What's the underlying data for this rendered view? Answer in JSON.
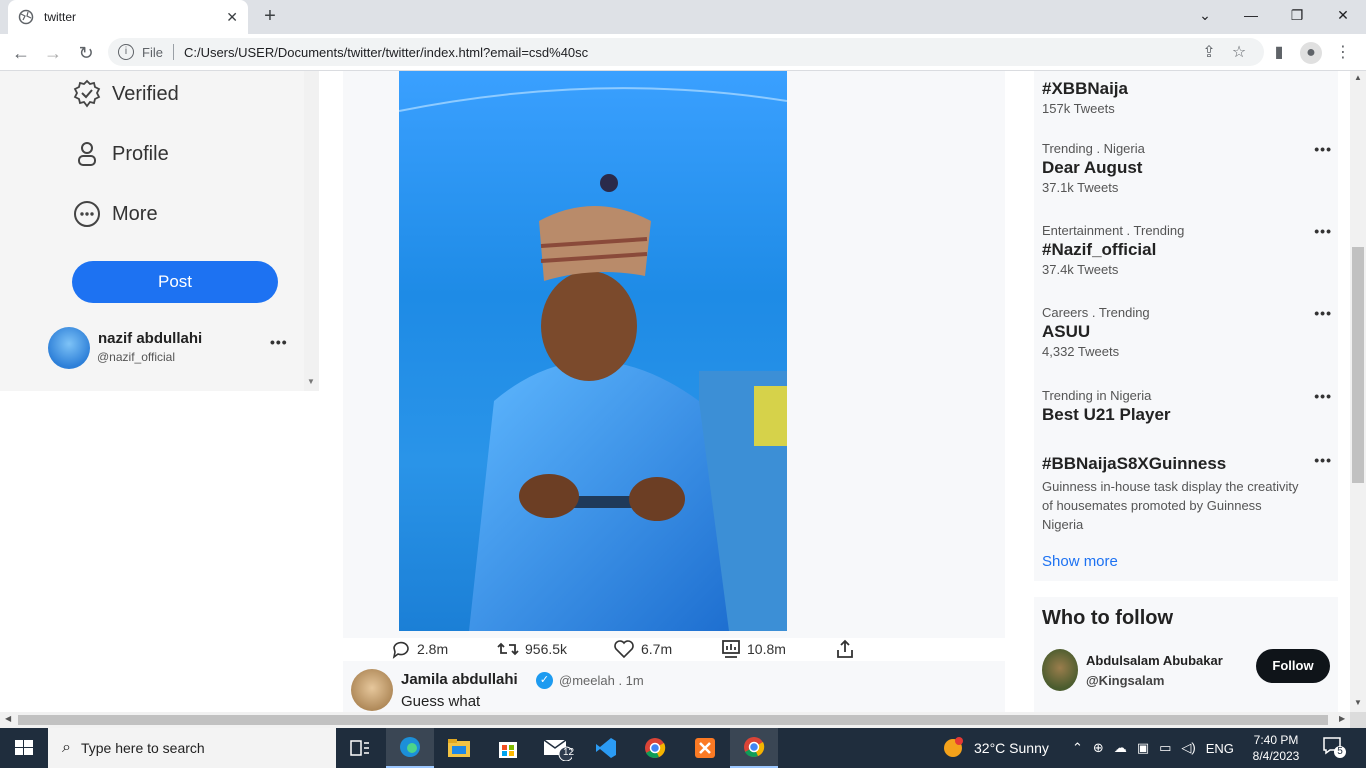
{
  "browser": {
    "tab_title": "twitter",
    "close_glyph": "✕",
    "newtab_glyph": "+",
    "file_label": "File",
    "url": "C:/Users/USER/Documents/twitter/twitter/index.html?email=csd%40sc"
  },
  "sidebar": {
    "items": [
      {
        "label": "Verified",
        "icon": "verified-badge-icon"
      },
      {
        "label": "Profile",
        "icon": "person-icon"
      },
      {
        "label": "More",
        "icon": "more-circle-icon"
      }
    ],
    "post_label": "Post",
    "user": {
      "name": "nazif abdullahi",
      "handle": "@nazif_official",
      "dots": "•••"
    }
  },
  "post": {
    "actions": [
      {
        "icon": "reply-icon",
        "count": "2.8m"
      },
      {
        "icon": "retweet-icon",
        "count": "956.5k"
      },
      {
        "icon": "like-icon",
        "count": "6.7m"
      },
      {
        "icon": "views-icon",
        "count": "10.8m"
      },
      {
        "icon": "share-icon",
        "count": ""
      }
    ]
  },
  "next_post": {
    "name": "Jamila abdullahi",
    "verified_glyph": "✓",
    "meta": "@meelah . 1m",
    "text": "Guess what"
  },
  "trends": {
    "items": [
      {
        "category": "",
        "tag": "#XBBNaija",
        "count": "157k Tweets"
      },
      {
        "category": "Trending . Nigeria",
        "tag": "Dear August",
        "count": "37.1k Tweets"
      },
      {
        "category": "Entertainment . Trending",
        "tag": "#Nazif_official",
        "count": "37.4k Tweets"
      },
      {
        "category": "Careers . Trending",
        "tag": "ASUU",
        "count": "4,332 Tweets"
      },
      {
        "category": "Trending in Nigeria",
        "tag": "Best U21 Player",
        "count": ""
      },
      {
        "category": "",
        "tag": "#BBNaijaS8XGuinness",
        "count": "",
        "desc": "Guinness in-house task display the creativity of housemates promoted by Guinness Nigeria"
      }
    ],
    "dots": "•••",
    "show_more": "Show more"
  },
  "who_to_follow": {
    "heading": "Who to follow",
    "name": "Abdulsalam Abubakar",
    "handle": "@Kingsalam",
    "follow_label": "Follow"
  },
  "taskbar": {
    "search_placeholder": "Type here to search",
    "weather": "32°C  Sunny",
    "language": "ENG",
    "time": "7:40 PM",
    "date": "8/4/2023",
    "notifications": "5",
    "mail_badge": "12"
  },
  "colors": {
    "accent": "#1d72f2",
    "taskbar": "#1f2d3d"
  }
}
